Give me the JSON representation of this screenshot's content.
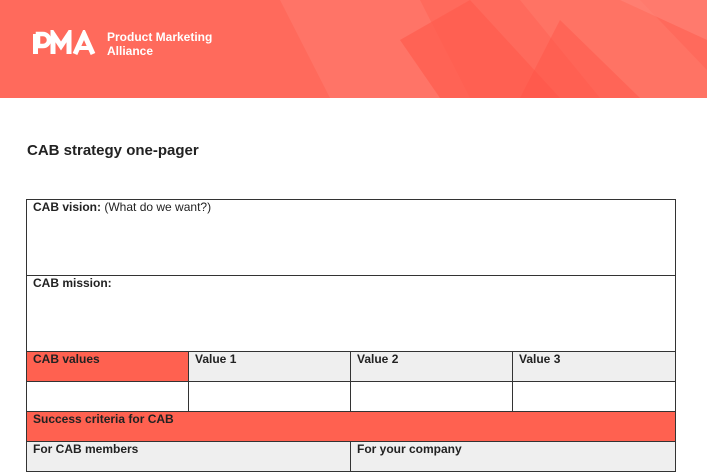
{
  "brand": {
    "mark": "PMA",
    "name_line1": "Product Marketing",
    "name_line2": "Alliance"
  },
  "document": {
    "title": "CAB strategy one-pager"
  },
  "table": {
    "vision_label": "CAB vision:",
    "vision_hint": "(What do we want?)",
    "mission_label": "CAB mission:",
    "values_label": "CAB values",
    "value_headers": [
      "Value 1",
      "Value 2",
      "Value 3"
    ],
    "success_label": "Success criteria for CAB",
    "for_members_label": "For CAB members",
    "for_company_label": "For your company"
  },
  "colors": {
    "banner": "#ff6a5c",
    "accent_cell": "#ff6150",
    "header_cell": "#efefef"
  }
}
